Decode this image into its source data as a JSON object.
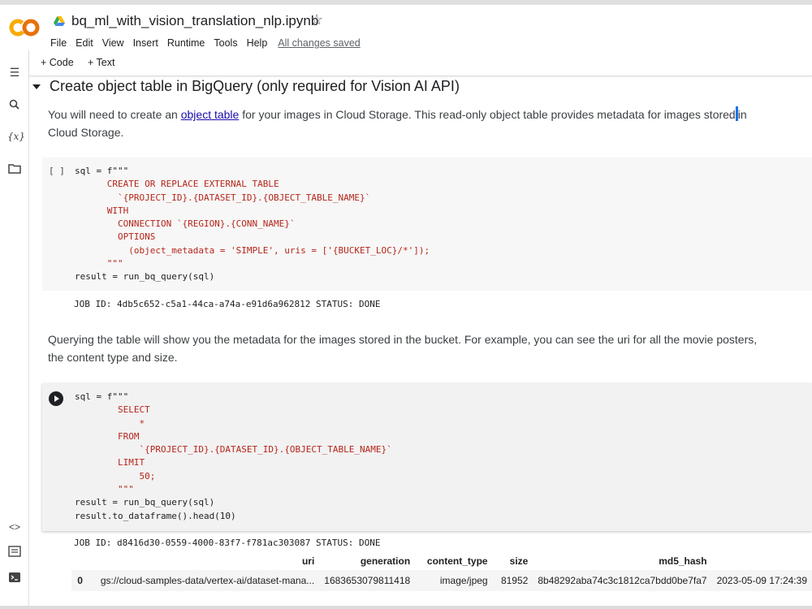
{
  "notebook": {
    "title": "bq_ml_with_vision_translation_nlp.ipynb",
    "menu": [
      "File",
      "Edit",
      "View",
      "Insert",
      "Runtime",
      "Tools",
      "Help"
    ],
    "save_status": "All changes saved"
  },
  "toolbar": {
    "add_code": "+ Code",
    "add_text": "+ Text"
  },
  "sidebar_icons": [
    "table-of-contents-icon",
    "search-icon",
    "variables-icon",
    "files-icon",
    "code-snippets-icon",
    "command-palette-icon",
    "terminal-icon"
  ],
  "section": {
    "title": "Create object table in BigQuery (only required for Vision AI API)"
  },
  "text1": {
    "before_link": "You will need to create an ",
    "link": "object table",
    "after_link": " for your images in Cloud Storage. This read-only object table provides metadata for images stored",
    "after_cursor": "in",
    "line2": "Cloud Storage."
  },
  "cell1": {
    "status": "[ ]",
    "lines": [
      "sql = f\"\"\"",
      "      CREATE OR REPLACE EXTERNAL TABLE",
      "        `{PROJECT_ID}.{DATASET_ID}.{OBJECT_TABLE_NAME}`",
      "      WITH",
      "        CONNECTION `{REGION}.{CONN_NAME}`",
      "        OPTIONS",
      "          (object_metadata = 'SIMPLE', uris = ['{BUCKET_LOC}/*']);",
      "      \"\"\"",
      "result = run_bq_query(sql)"
    ],
    "output": "JOB ID: 4db5c652-c5a1-44ca-a74a-e91d6a962812 STATUS: DONE"
  },
  "text2": {
    "line1": "Querying the table will show you the metadata for the images stored in the bucket. For example, you can see the uri for all the movie posters,",
    "line2": "the content type and size."
  },
  "cell2": {
    "lines": [
      "sql = f\"\"\"",
      "        SELECT",
      "            *",
      "        FROM",
      "            `{PROJECT_ID}.{DATASET_ID}.{OBJECT_TABLE_NAME}`",
      "        LIMIT",
      "            50;",
      "        \"\"\"",
      "result = run_bq_query(sql)",
      "result.to_dataframe().head(10)"
    ],
    "output": "JOB ID: d8416d30-0559-4000-83f7-f781ac303087 STATUS: DONE"
  },
  "dataframe": {
    "columns": [
      "",
      "uri",
      "generation",
      "content_type",
      "size",
      "md5_hash",
      ""
    ],
    "rows": [
      [
        "0",
        "gs://cloud-samples-data/vertex-ai/dataset-mana...",
        "1683653079811418",
        "image/jpeg",
        "81952",
        "8b48292aba74c3c1812ca7bdd0be7fa7",
        "2023-05-09 17:24:39"
      ]
    ]
  }
}
